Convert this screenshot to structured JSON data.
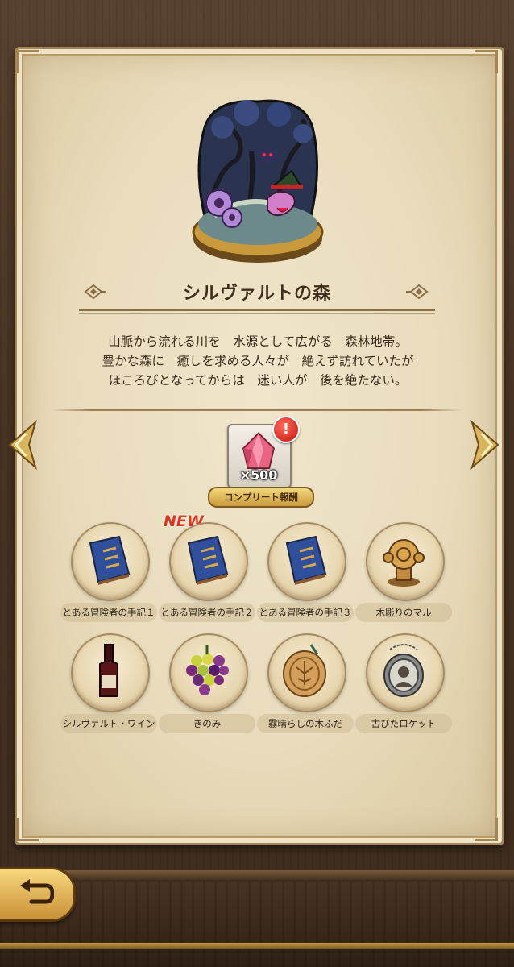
{
  "area": {
    "title": "シルヴァルトの森",
    "description": [
      "山脈から流れる川を　水源として広がる　森林地帯。",
      "豊かな森に　癒しを求める人々が　絶えず訪れていたが",
      "ほころびとなってからは　迷い人が　後を絶たない。"
    ]
  },
  "reward": {
    "quantity": "×500",
    "label": "コンプリート報酬",
    "alert": "!",
    "icon": "pink-gem-icon"
  },
  "badges": {
    "new": "NEW"
  },
  "items": [
    {
      "label": "とある冒険者の手記１",
      "icon": "blue-book-icon"
    },
    {
      "label": "とある冒険者の手記２",
      "icon": "blue-book-icon"
    },
    {
      "label": "とある冒険者の手記３",
      "icon": "blue-book-icon"
    },
    {
      "label": "木彫りのマル",
      "icon": "wooden-statue-icon"
    },
    {
      "label": "シルヴァルト・ワイン",
      "icon": "wine-bottle-icon"
    },
    {
      "label": "きのみ",
      "icon": "grapes-icon"
    },
    {
      "label": "霧晴らしの木ふだ",
      "icon": "wooden-tag-icon"
    },
    {
      "label": "古びたロケット",
      "icon": "locket-icon"
    }
  ],
  "colors": {
    "parchment": "#ebdec0",
    "title_text": "#3e2f1d",
    "new_tag": "#e23319",
    "gold": "#d9a84a"
  }
}
